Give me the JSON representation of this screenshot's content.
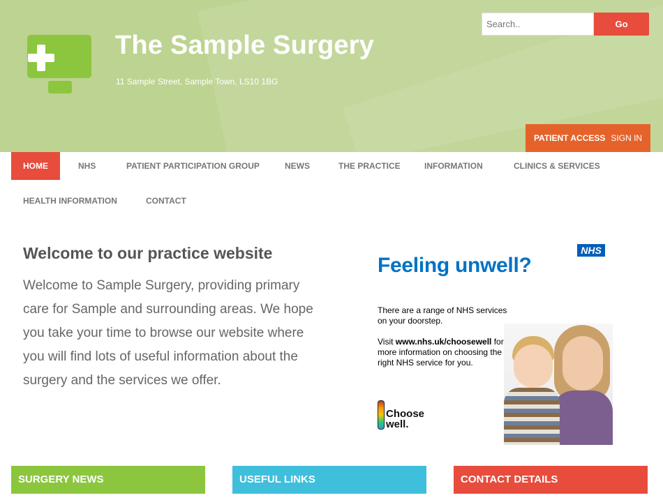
{
  "site": {
    "title": "The Sample Surgery",
    "address": "11 Sample Street, Sample Town, LS10 1BG"
  },
  "search": {
    "placeholder": "Search..",
    "go_label": "Go"
  },
  "patient_access": {
    "label": "PATIENT ACCESS",
    "sign_in": "SIGN IN"
  },
  "nav": {
    "items": [
      {
        "label": "HOME",
        "active": true
      },
      {
        "label": "NHS"
      },
      {
        "label": "PATIENT PARTICIPATION GROUP"
      },
      {
        "label": "NEWS"
      },
      {
        "label": "THE PRACTICE"
      },
      {
        "label": "INFORMATION"
      },
      {
        "label": "CLINICS & SERVICES"
      },
      {
        "label": "HEALTH INFORMATION"
      },
      {
        "label": "CONTACT"
      }
    ]
  },
  "main": {
    "heading": "Welcome to our practice website",
    "body": "Welcome to Sample Surgery, providing primary care for Sample and surrounding areas. We hope you take your time to browse our website where you will find lots of useful information about the surgery and the services we offer."
  },
  "promo": {
    "nhs": "NHS",
    "headline": "Feeling unwell?",
    "line1": "There are a range of NHS services on your doorstep.",
    "line2_prefix": "Visit ",
    "line2_url": "www.nhs.uk/choosewell",
    "line2_suffix": " for more information on choosing the right NHS service for you.",
    "choose_well": "Choose well."
  },
  "boxes": {
    "news": "SURGERY NEWS",
    "links": "USEFUL LINKS",
    "contact": "CONTACT DETAILS"
  },
  "colors": {
    "header_bg": "#bdd391",
    "accent_red": "#e74c3c",
    "patient_access_orange": "#e5632a",
    "green": "#8cc63e",
    "cyan": "#3fbfdc",
    "nhs_blue": "#005eb8"
  }
}
